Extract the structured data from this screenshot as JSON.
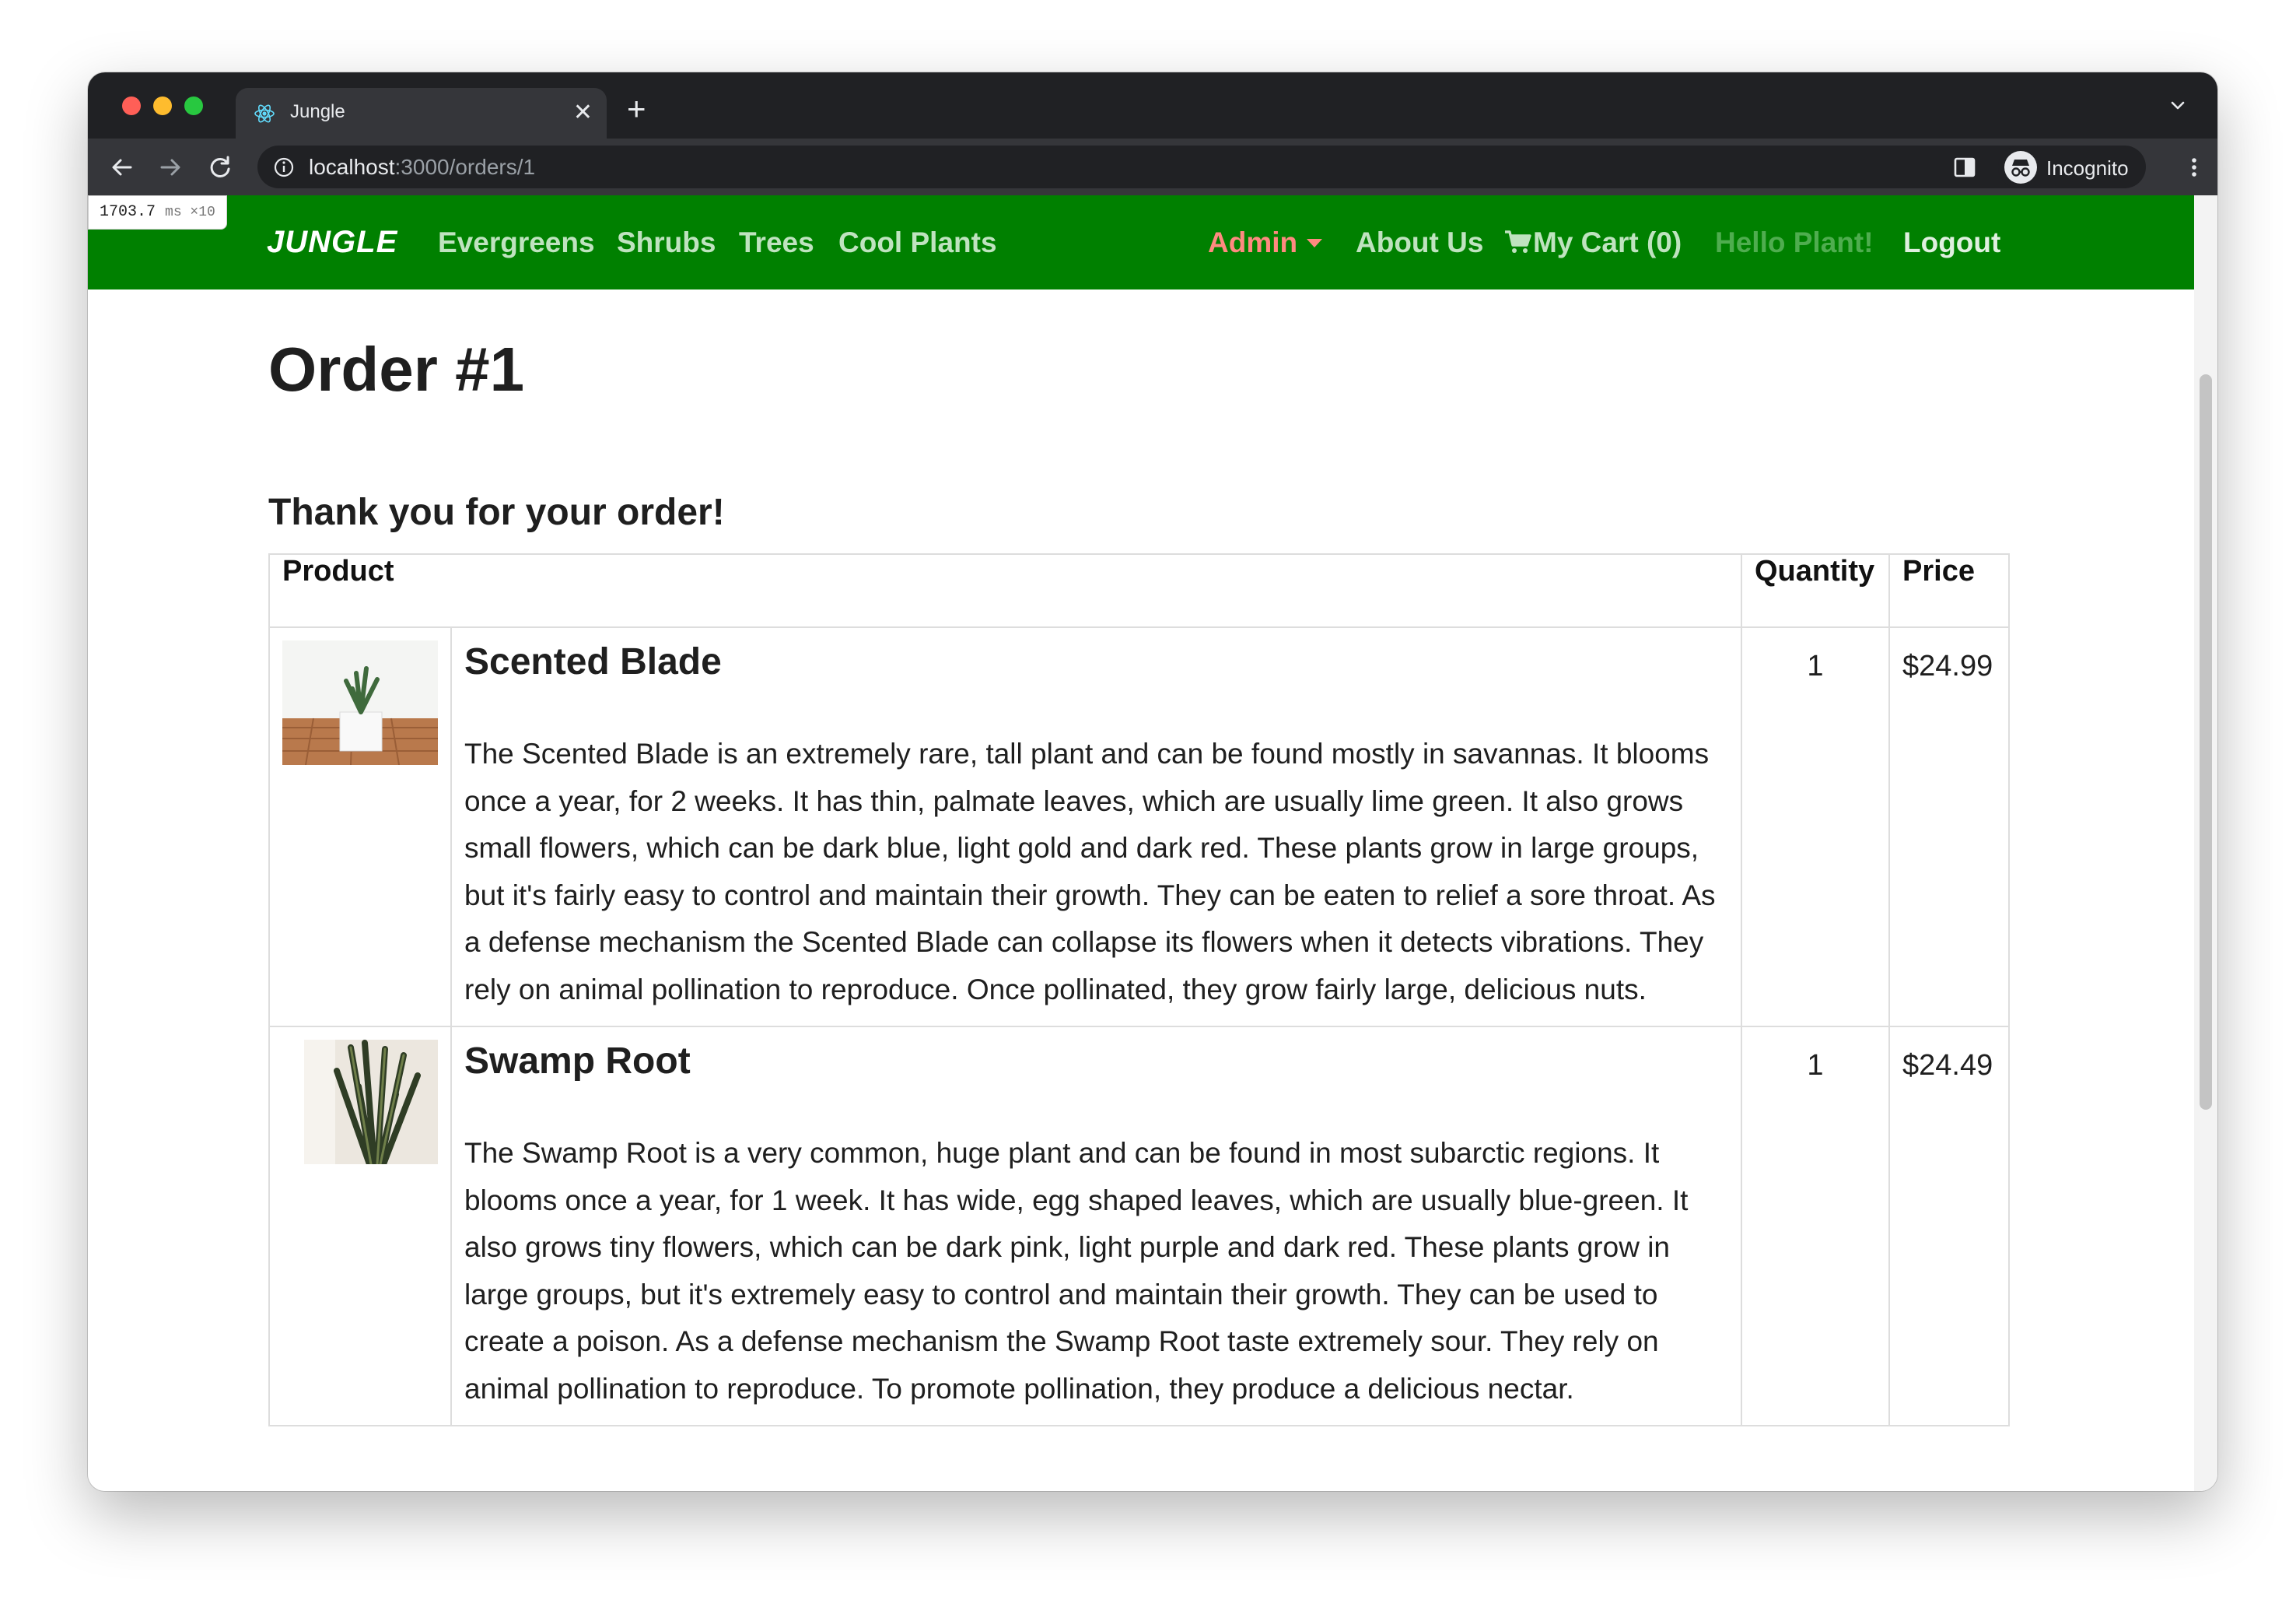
{
  "browser": {
    "tab_title": "Jungle",
    "url_host": "localhost",
    "url_path": ":3000/orders/1",
    "profile_label": "Incognito"
  },
  "perf_badge": {
    "value": "1703.7",
    "unit": "ms ×10"
  },
  "navbar": {
    "brand": "JUNGLE",
    "links": [
      "Evergreens",
      "Shrubs",
      "Trees",
      "Cool Plants"
    ],
    "admin": "Admin",
    "about": "About Us",
    "cart": "My Cart (0)",
    "hello": "Hello Plant!",
    "logout": "Logout",
    "colors": {
      "bar": "#008000",
      "admin": "#ff8a80"
    }
  },
  "page": {
    "title": "Order #1",
    "thanks": "Thank you for your order!"
  },
  "table": {
    "headers": {
      "product": "Product",
      "quantity": "Quantity",
      "price": "Price"
    },
    "rows": [
      {
        "name": "Scented Blade",
        "description": "The Scented Blade is an extremely rare, tall plant and can be found mostly in savannas. It blooms once a year, for 2 weeks. It has thin, palmate leaves, which are usually lime green. It also grows small flowers, which can be dark blue, light gold and dark red. These plants grow in large groups, but it's fairly easy to control and maintain their growth. They can be eaten to relief a sore throat. As a defense mechanism the Scented Blade can collapse its flowers when it detects vibrations. They rely on animal pollination to reproduce. Once pollinated, they grow fairly large, delicious nuts.",
        "quantity": "1",
        "price": "$24.99",
        "image_icon": "potted-plant-image"
      },
      {
        "name": "Swamp Root",
        "description": "The Swamp Root is a very common, huge plant and can be found in most subarctic regions. It blooms once a year, for 1 week. It has wide, egg shaped leaves, which are usually blue-green. It also grows tiny flowers, which can be dark pink, light purple and dark red. These plants grow in large groups, but it's extremely easy to control and maintain their growth. They can be used to create a poison. As a defense mechanism the Swamp Root taste extremely sour. They rely on animal pollination to reproduce. To promote pollination, they produce a delicious nectar.",
        "quantity": "1",
        "price": "$24.49",
        "image_icon": "snake-plant-image"
      }
    ]
  }
}
